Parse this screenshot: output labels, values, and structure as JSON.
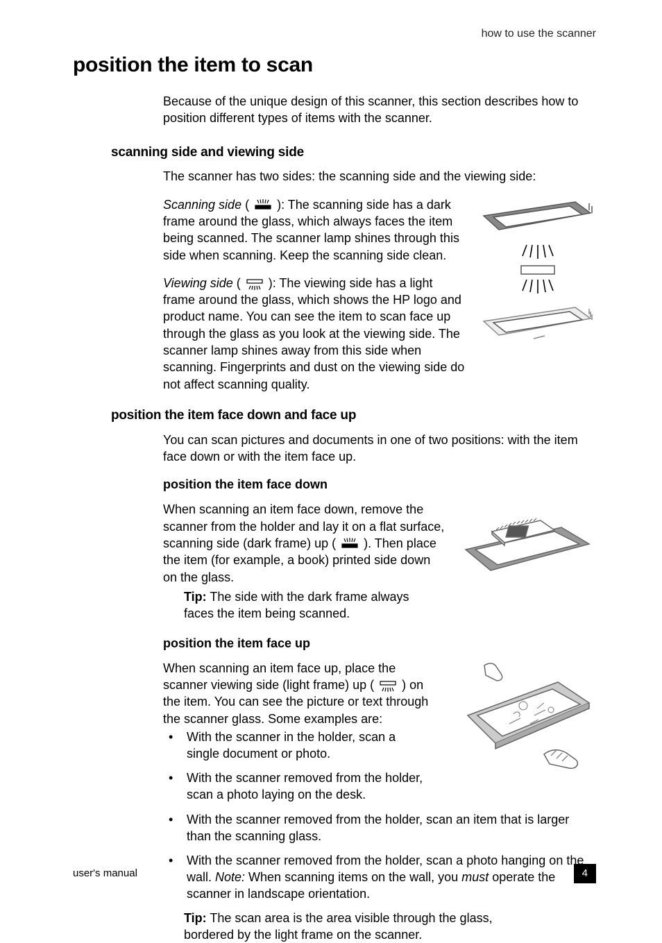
{
  "header": {
    "chapter": "how to use the scanner"
  },
  "title": "position the item to scan",
  "intro": "Because of the unique design of this scanner, this section describes how to position different types of items with the scanner.",
  "sec1": {
    "heading": "scanning side and viewing side",
    "lead": "The scanner has two sides: the scanning side and the viewing side:",
    "scan_label": "Scanning side",
    "scan_open": " ( ",
    "scan_close": " ): ",
    "scan_text": "The scanning side has a dark frame around the glass, which always faces the item being scanned. The scanner lamp shines through this side when scanning. Keep the scanning side clean.",
    "view_label": "Viewing side",
    "view_open": " ( ",
    "view_close": " ): ",
    "view_text": "The viewing side has a light frame around the glass, which shows the HP logo and product name. You can see the item to scan face up through the glass as you look at the viewing side. The scanner lamp shines away from this side when scanning. Fingerprints and dust on the viewing side do not affect scanning quality."
  },
  "sec2": {
    "heading": "position the item face down and face up",
    "lead": "You can scan pictures and documents in one of two positions: with the item face down or with the item face up.",
    "sub1_heading": "position the item face down",
    "sub1_text_a": "When scanning an item face down, remove the scanner from the holder and lay it on a flat surface, scanning side (dark frame) up ( ",
    "sub1_text_b": " ). Then place the item (for example, a book) printed side down on the glass.",
    "tip1_label": "Tip:",
    "tip1_text": "   The side with the dark frame always faces the item being scanned.",
    "sub2_heading": "position the item face up",
    "sub2_text_a": "When scanning an item face up, place the scanner viewing side (light frame) up ( ",
    "sub2_text_b": " ) on the item. You can see the picture or text through the scanner glass. Some examples are:",
    "bullets": [
      "With the scanner in the holder, scan a single document or photo.",
      "With the scanner removed from the holder, scan a photo laying on the desk.",
      "With the scanner removed from the holder, scan an item that is larger than the scanning glass."
    ],
    "bullet4_a": "With the scanner removed from the holder, scan a photo hanging on the wall. ",
    "bullet4_note": "Note:",
    "bullet4_b": " When scanning items on the wall, you ",
    "bullet4_must": "must",
    "bullet4_c": " operate the scanner in landscape orientation.",
    "tip2_label": "Tip:",
    "tip2_text": "   The scan area is the area visible through the glass, bordered by the light frame on the scanner."
  },
  "footer": {
    "left": "user's manual",
    "page": "4"
  }
}
